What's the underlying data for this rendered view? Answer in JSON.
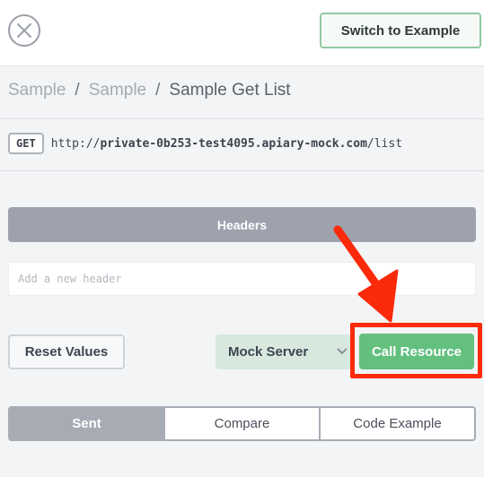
{
  "topbar": {
    "switch_label": "Switch to Example"
  },
  "breadcrumb": {
    "items": [
      "Sample",
      "Sample",
      "Sample Get List"
    ],
    "separator": "/"
  },
  "endpoint": {
    "method": "GET",
    "url_prefix": "http://",
    "url_host": "private-0b253-test4095.apiary-mock.com",
    "url_path": "/list"
  },
  "headers": {
    "title": "Headers",
    "input_placeholder": "Add a new header",
    "input_value": ""
  },
  "actions": {
    "reset_label": "Reset Values",
    "server_selected": "Mock Server",
    "call_label": "Call Resource"
  },
  "tabs": [
    {
      "label": "Sent",
      "active": true
    },
    {
      "label": "Compare",
      "active": false
    },
    {
      "label": "Code Example",
      "active": false
    }
  ],
  "colors": {
    "accent_green": "#63c07f",
    "annotation_red": "#fb2a0a",
    "headers_gray": "#9da2ad"
  },
  "icons": {
    "close": "close-circle-icon",
    "select": "chevron-down-icon",
    "annotation": "red-arrow-pointer"
  }
}
